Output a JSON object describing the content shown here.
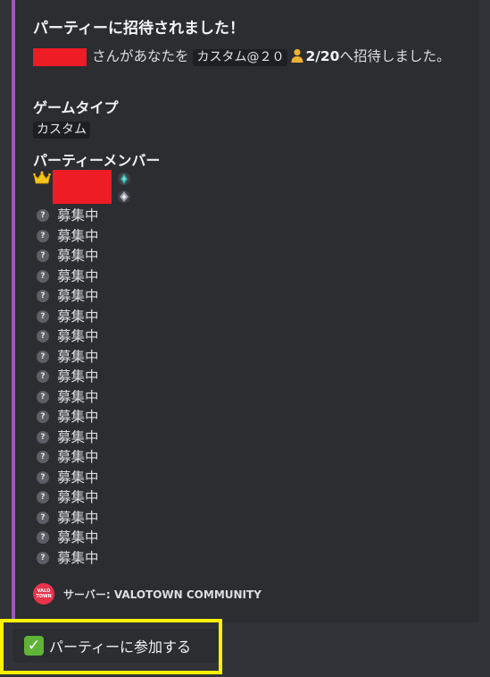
{
  "embed": {
    "accent_color": "#9b59b6",
    "title": "パーティーに招待されました！",
    "description": {
      "text_before": "さんがあなたを",
      "party_name": "カスタム@２０",
      "member_icon": "person-icon",
      "member_count": "2/20",
      "text_after": "へ招待しました。"
    },
    "fields": {
      "game_type": {
        "name": "ゲームタイプ",
        "value": "カスタム"
      },
      "members": {
        "name": "パーティーメンバー",
        "leader_icon": "crown-icon",
        "open_slot_icon": "question-icon",
        "open_slots": [
          "募集中",
          "募集中",
          "募集中",
          "募集中",
          "募集中",
          "募集中",
          "募集中",
          "募集中",
          "募集中",
          "募集中",
          "募集中",
          "募集中",
          "募集中",
          "募集中",
          "募集中",
          "募集中",
          "募集中",
          "募集中"
        ]
      }
    },
    "footer": {
      "logo_text_top": "VALO",
      "logo_text_bottom": "TOWN",
      "text": "サーバー: VALOTOWN COMMUNITY"
    }
  },
  "join_button": {
    "icon": "check-icon",
    "label": "パーティーに参加する",
    "highlight_color": "#fff200"
  }
}
